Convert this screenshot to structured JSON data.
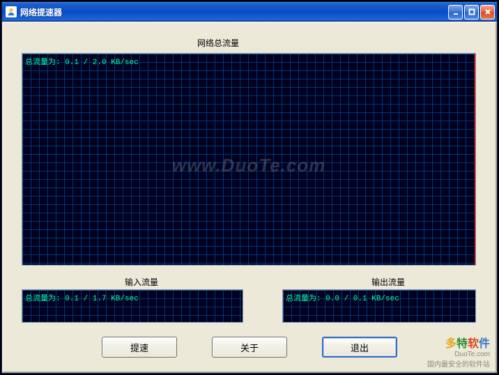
{
  "window": {
    "title": "网络提速器"
  },
  "labels": {
    "total": "网络总流量",
    "input": "输入流量",
    "output": "输出流量"
  },
  "graphs": {
    "total_readout": "总流量为: 0.1 / 2.0 KB/sec",
    "input_readout": "总流量为: 0.1 / 1.7 KB/sec",
    "output_readout": "总流量为: 0.0 / 0.1 KB/sec"
  },
  "watermark": "www.DuoTe.com",
  "buttons": {
    "speedup": "提速",
    "about": "关于",
    "exit": "退出"
  },
  "brand": {
    "name": "多特软件",
    "url": "DuoTe.com",
    "tagline": "国内最安全的软件站"
  }
}
